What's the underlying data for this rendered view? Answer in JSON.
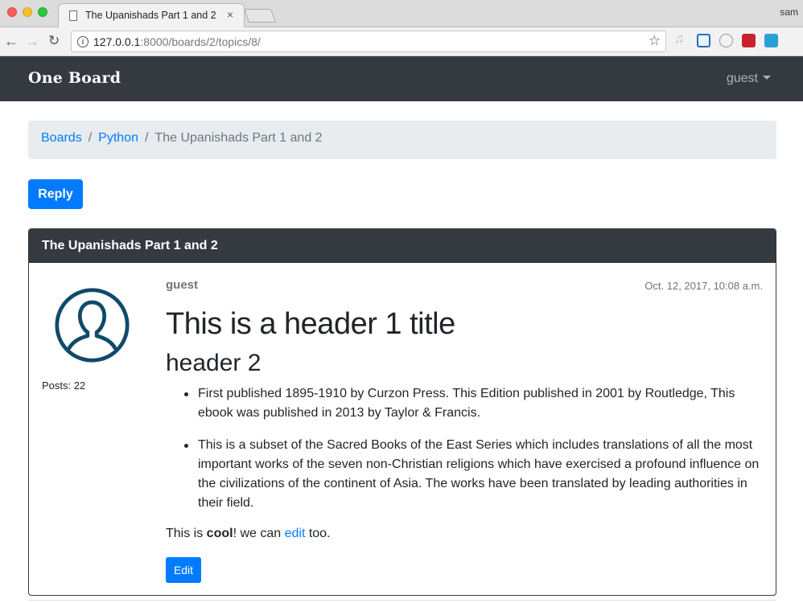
{
  "browser": {
    "tab_title": "The Upanishads Part 1 and 2",
    "tab_close": "×",
    "profile": "sam",
    "url_host": "127.0.0.1",
    "url_rest": ":8000/boards/2/topics/8/",
    "info_glyph": "i",
    "star_glyph": "☆",
    "back_glyph": "←",
    "forward_glyph": "→",
    "reload_glyph": "↻"
  },
  "navbar": {
    "brand": "One Board",
    "user": "guest"
  },
  "breadcrumb": {
    "items": [
      "Boards",
      "Python"
    ],
    "separator": "/",
    "active": "The Upanishads Part 1 and 2"
  },
  "reply_label": "Reply",
  "topic": {
    "title": "The Upanishads Part 1 and 2"
  },
  "post": {
    "posts_label": "Posts: 22",
    "author": "guest",
    "date": "Oct. 12, 2017, 10:08 a.m.",
    "h1": "This is a header 1 title",
    "h2": "header 2",
    "bullets": [
      "First published 1895-1910 by Curzon Press. This Edition published in 2001 by Routledge, This ebook was published in 2013 by Taylor & Francis.",
      "This is a subset of the Sacred Books of the East Series which includes translations of all the most important works of the seven non-Christian religions which have exercised a profound influence on the civilizations of the continent of Asia. The works have been translated by leading authorities in their field."
    ],
    "para_start": "This is ",
    "para_bold": "cool",
    "para_mid": "! we can ",
    "para_link": "edit",
    "para_end": " too.",
    "edit_label": "Edit"
  },
  "colors": {
    "primary": "#007bff",
    "dark": "#343a40",
    "avatar": "#0f4a6a"
  }
}
